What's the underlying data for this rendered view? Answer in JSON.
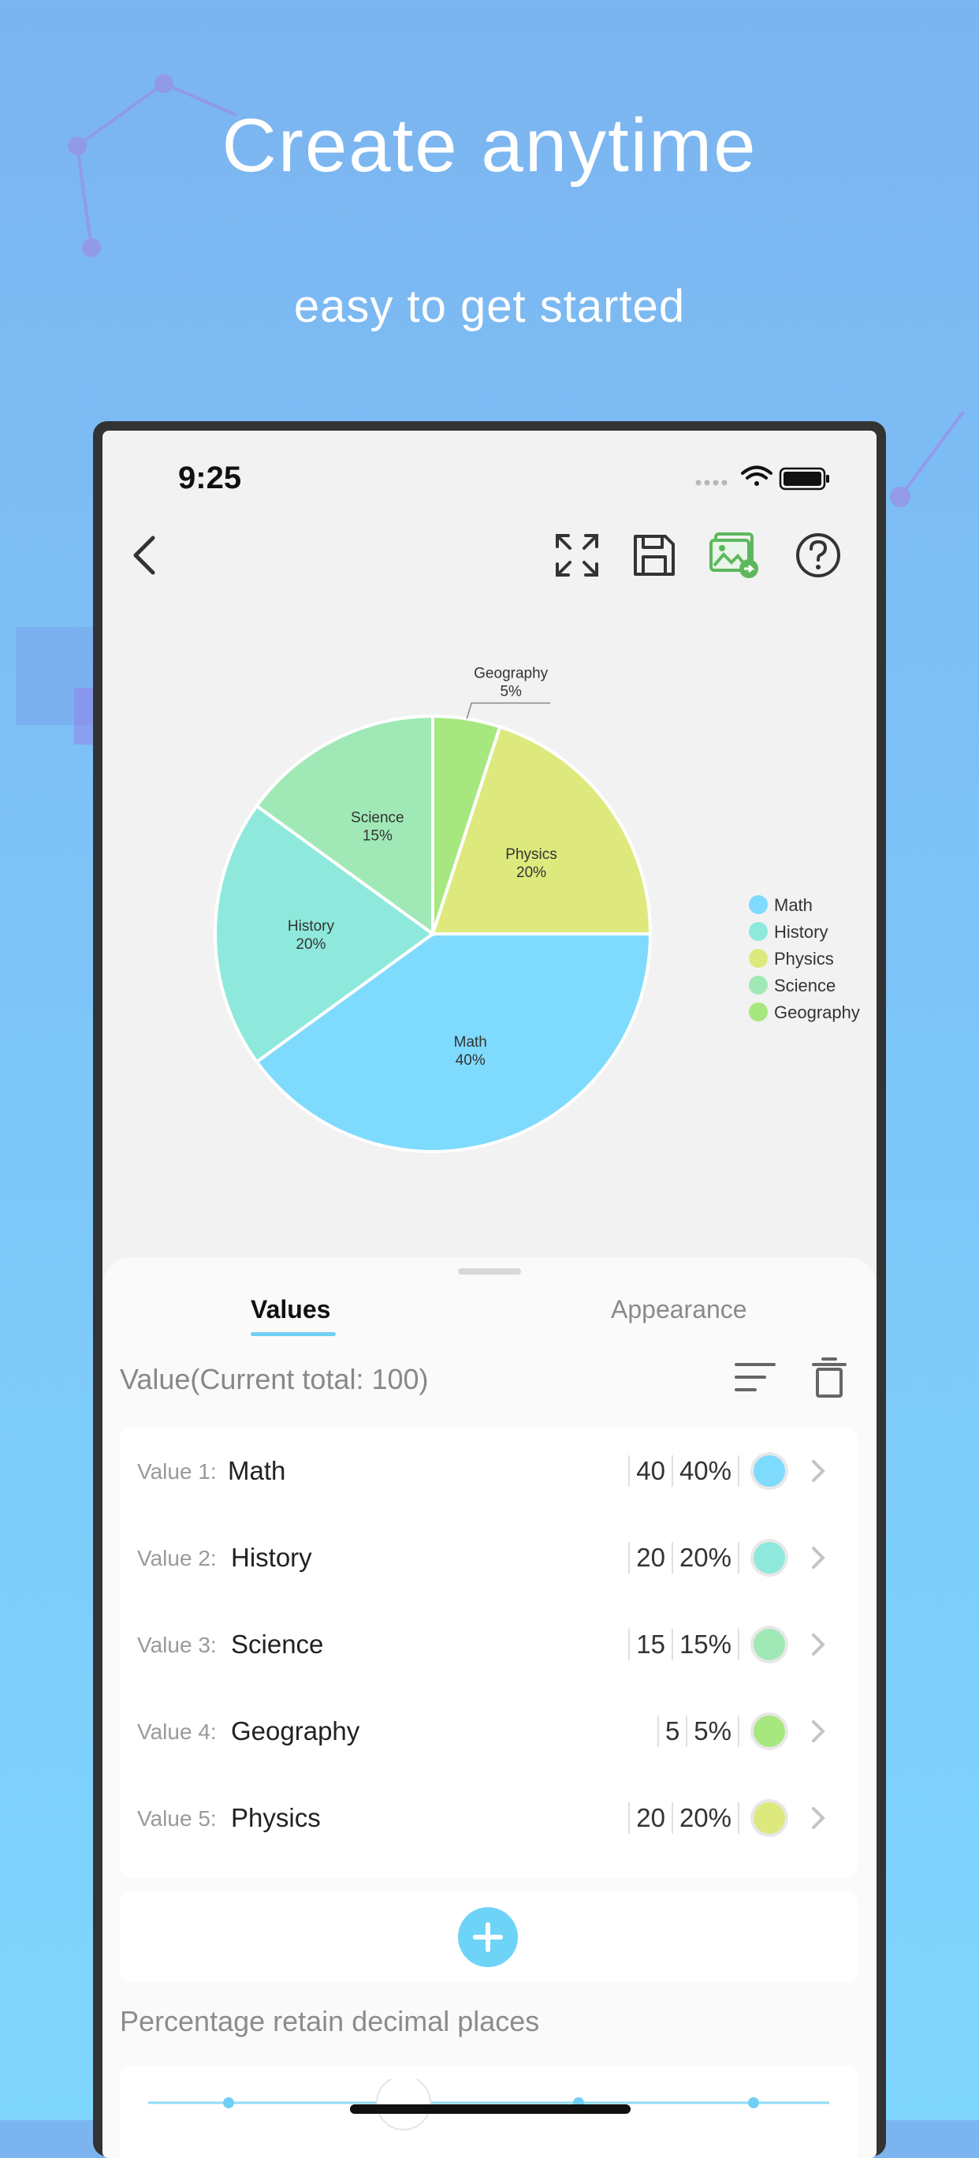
{
  "hero": {
    "title": "Create anytime",
    "subtitle": "easy to get started"
  },
  "status": {
    "time": "9:25"
  },
  "toolbar": {
    "back": "chevron-left-icon",
    "fullscreen": "fullscreen-icon",
    "save": "save-icon",
    "export_image": "export-image-icon",
    "help": "help-icon"
  },
  "chart_data": {
    "type": "pie",
    "slices": [
      {
        "name": "Math",
        "value": 40,
        "percent": "40%",
        "color": "#7fdbfd"
      },
      {
        "name": "History",
        "value": 20,
        "percent": "20%",
        "color": "#8ee9dc"
      },
      {
        "name": "Science",
        "value": 15,
        "percent": "15%",
        "color": "#a0e9b6"
      },
      {
        "name": "Geography",
        "value": 5,
        "percent": "5%",
        "color": "#a6e87f"
      },
      {
        "name": "Physics",
        "value": 20,
        "percent": "20%",
        "color": "#dde97c"
      }
    ],
    "legend": [
      "Math",
      "History",
      "Physics",
      "Science",
      "Geography"
    ],
    "legend_position": "right"
  },
  "sheet": {
    "tabs": {
      "values": "Values",
      "appearance": "Appearance"
    },
    "total_label": "Value(Current total: 100)",
    "rows": [
      {
        "label": "Value 1:",
        "name": "Math",
        "value": "40",
        "percent": "40%",
        "color": "#7fdbfd"
      },
      {
        "label": "Value 2:",
        "name": "History",
        "value": "20",
        "percent": "20%",
        "color": "#8ee9dc"
      },
      {
        "label": "Value 3:",
        "name": "Science",
        "value": "15",
        "percent": "15%",
        "color": "#a0e9b6"
      },
      {
        "label": "Value 4:",
        "name": "Geography",
        "value": "5",
        "percent": "5%",
        "color": "#a6e87f"
      },
      {
        "label": "Value 5:",
        "name": "Physics",
        "value": "20",
        "percent": "20%",
        "color": "#dde97c"
      }
    ],
    "decimal_label": "Percentage retain decimal places"
  }
}
